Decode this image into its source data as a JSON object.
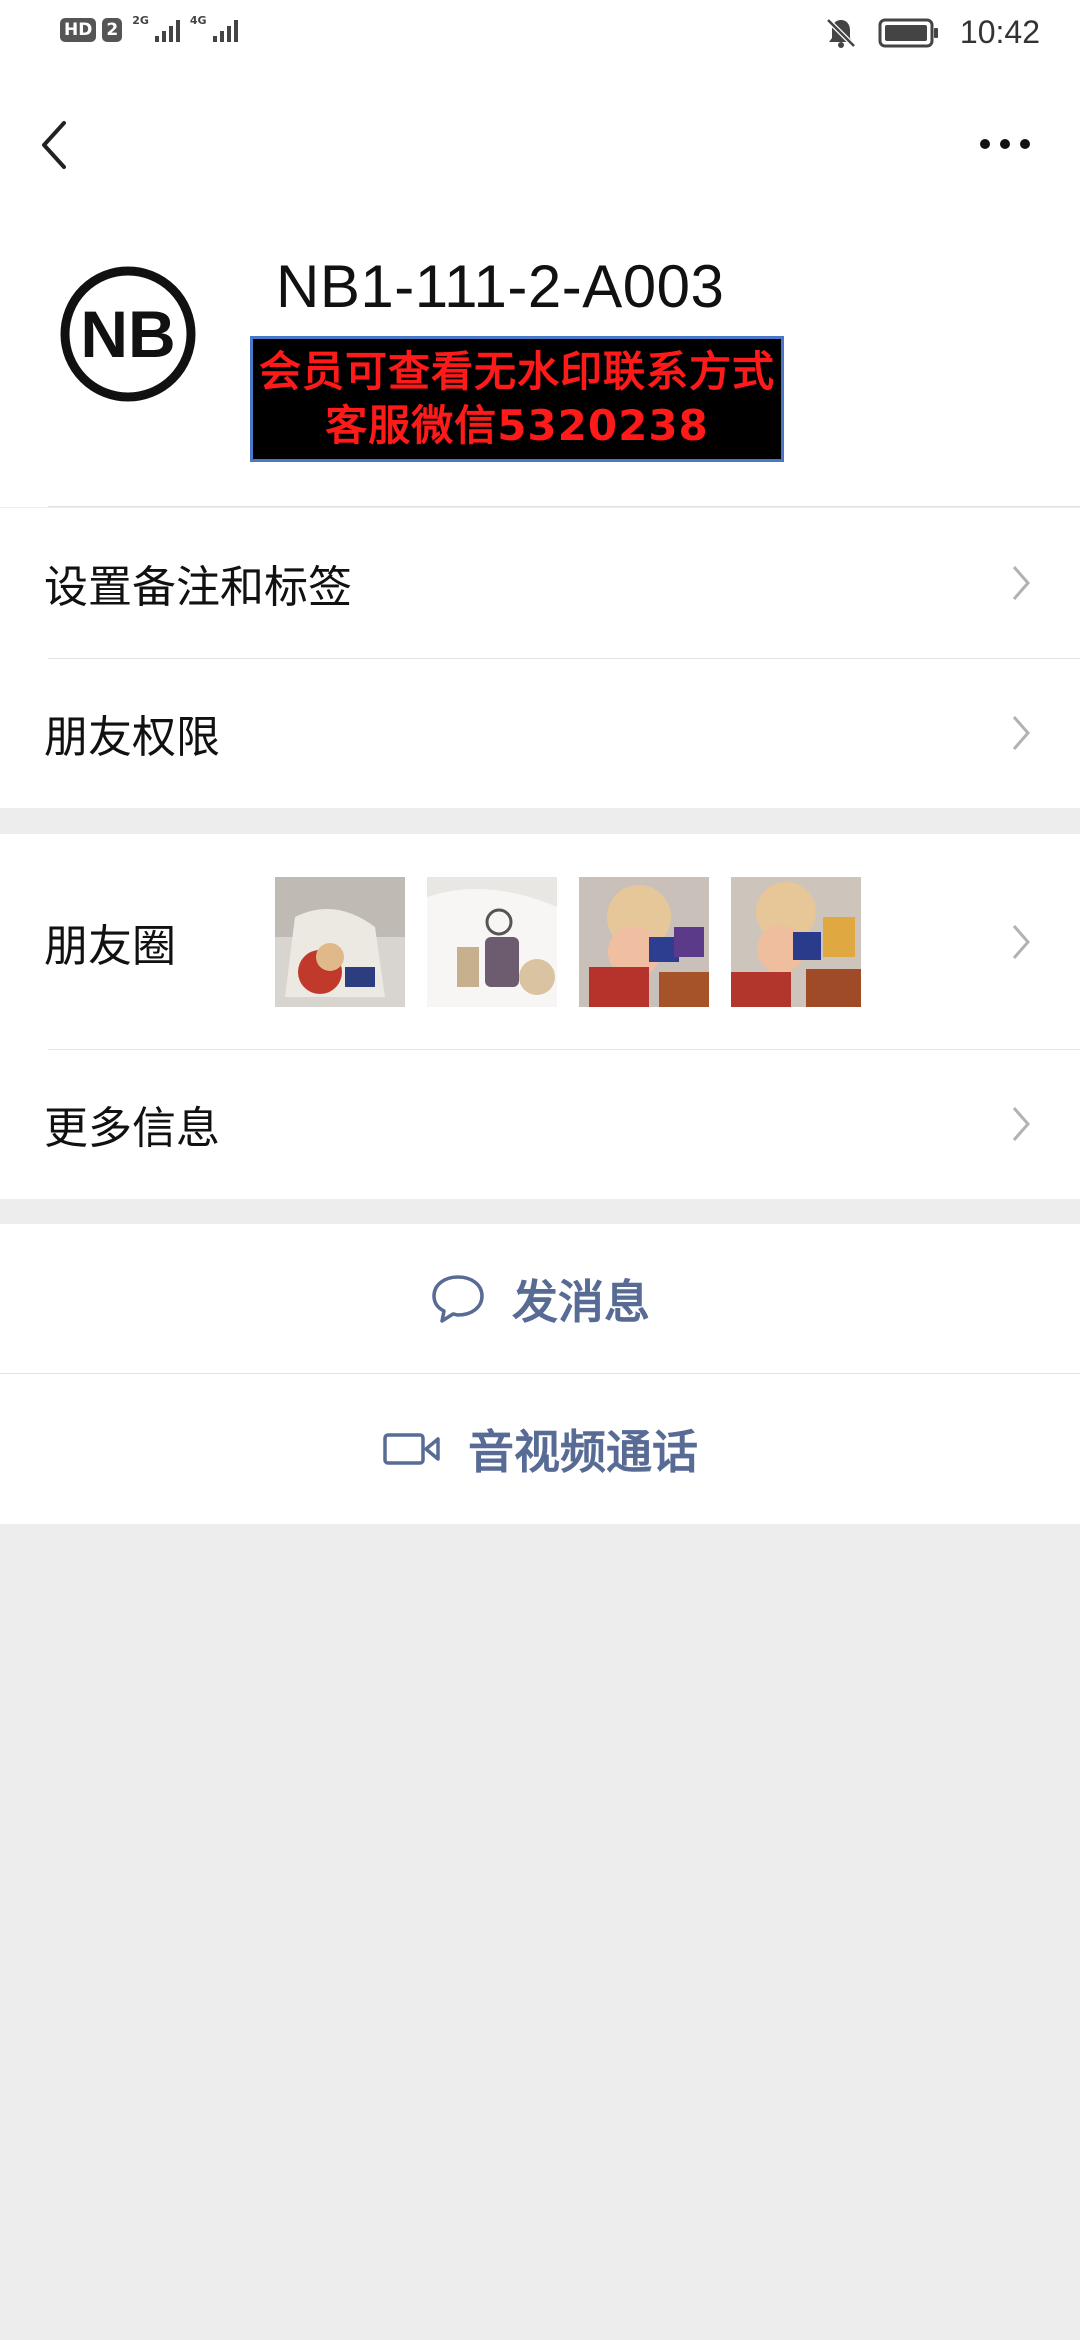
{
  "status_bar": {
    "hd_badge": "HD",
    "sim_badge": "2",
    "net1": "2G",
    "net2": "4G",
    "time": "10:42",
    "icons": [
      "mute-bell-icon",
      "battery-icon"
    ]
  },
  "nav": {
    "back_icon": "chevron-left-icon",
    "more_icon": "more-dots-icon"
  },
  "profile": {
    "avatar_text": "NB",
    "name": "NB1-111-2-A003",
    "watermark_line1": "会员可查看无水印联系方式",
    "watermark_line2": "客服微信5320238"
  },
  "rows": {
    "remark": "设置备注和标签",
    "permissions": "朋友权限",
    "moments": "朋友圈",
    "more_info": "更多信息"
  },
  "actions": {
    "message": "发消息",
    "call": "音视频通话"
  },
  "colors": {
    "link": "#576b95",
    "background": "#ededed",
    "watermark_text": "#ff1a1a"
  }
}
